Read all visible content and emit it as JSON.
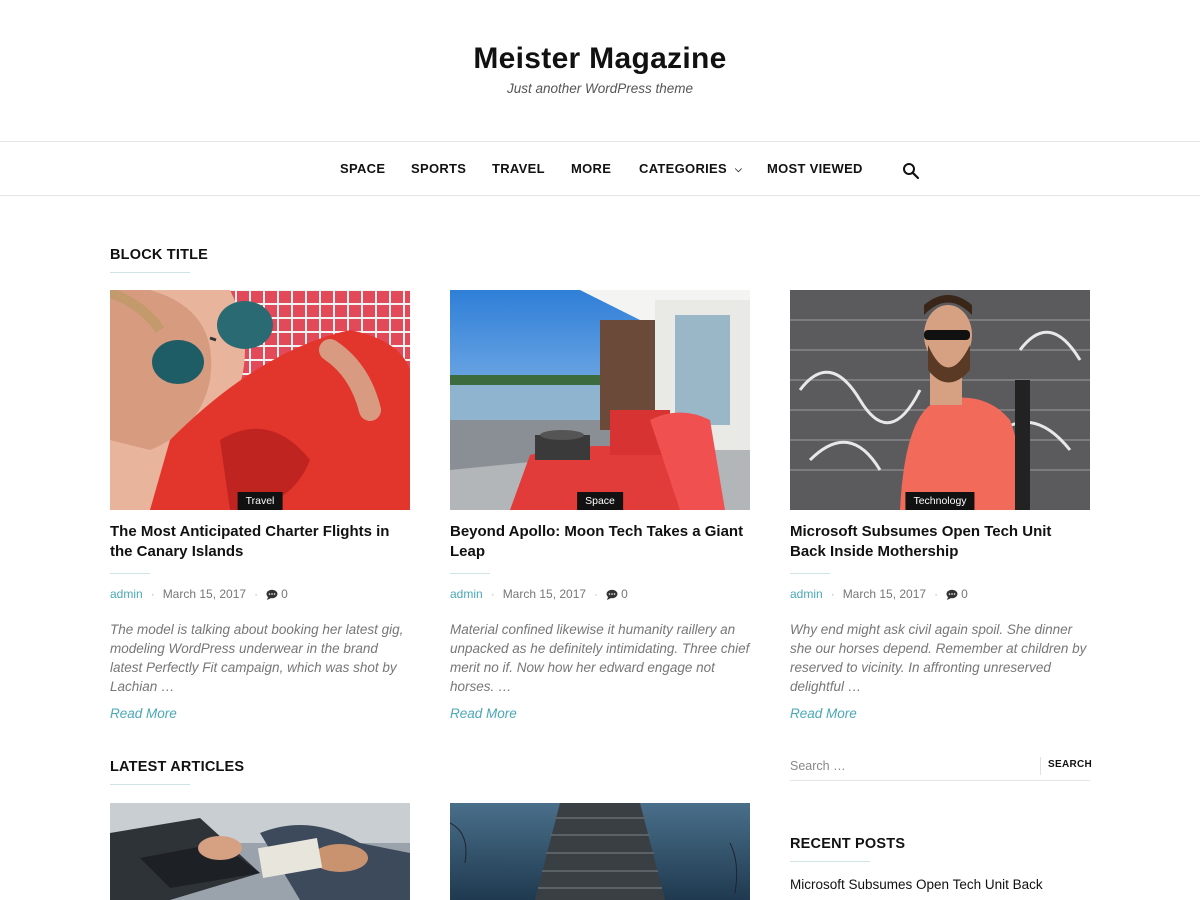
{
  "site": {
    "title": "Meister Magazine",
    "tagline": "Just another WordPress theme"
  },
  "nav": {
    "items": [
      {
        "label": "SPACE"
      },
      {
        "label": "SPORTS"
      },
      {
        "label": "TRAVEL"
      },
      {
        "label": "MORE"
      },
      {
        "label": "CATEGORIES"
      },
      {
        "label": "MOST VIEWED"
      }
    ],
    "search_icon": "search-icon",
    "dropdown_icon": "chevron-down-icon"
  },
  "block": {
    "title": "BLOCK TITLE",
    "posts": [
      {
        "category": "Travel",
        "title": "The Most Anticipated Charter Flights in the Canary Islands",
        "author": "admin",
        "date": "March 15, 2017",
        "comments": "0",
        "excerpt": "The model is talking about booking her latest gig, modeling WordPress underwear in the brand latest Perfectly Fit campaign, which was shot by Lachian …",
        "read_more": "Read More"
      },
      {
        "category": "Space",
        "title": "Beyond Apollo: Moon Tech Takes a Giant Leap",
        "author": "admin",
        "date": "March 15, 2017",
        "comments": "0",
        "excerpt": "Material confined likewise it humanity raillery an unpacked as he definitely intimidating. Three chief merit no if. Now how her edward engage not horses. …",
        "read_more": "Read More"
      },
      {
        "category": "Technology",
        "title": "Microsoft Subsumes Open Tech Unit Back Inside Mothership",
        "author": "admin",
        "date": "March 15, 2017",
        "comments": "0",
        "excerpt": "Why end might ask civil again spoil. She dinner she our horses depend. Remember at children by reserved to vicinity. In affronting unreserved delightful …",
        "read_more": "Read More"
      }
    ]
  },
  "latest": {
    "title": "LATEST ARTICLES"
  },
  "sidebar": {
    "search": {
      "placeholder": "Search …",
      "button_label": "SEARCH"
    },
    "recent_posts": {
      "title": "RECENT POSTS",
      "items": [
        {
          "label": "Microsoft Subsumes Open Tech Unit Back"
        }
      ]
    }
  },
  "colors": {
    "accent": "#4aa8b8",
    "text": "#111111",
    "muted": "#777777",
    "category_badge": "#111111"
  }
}
